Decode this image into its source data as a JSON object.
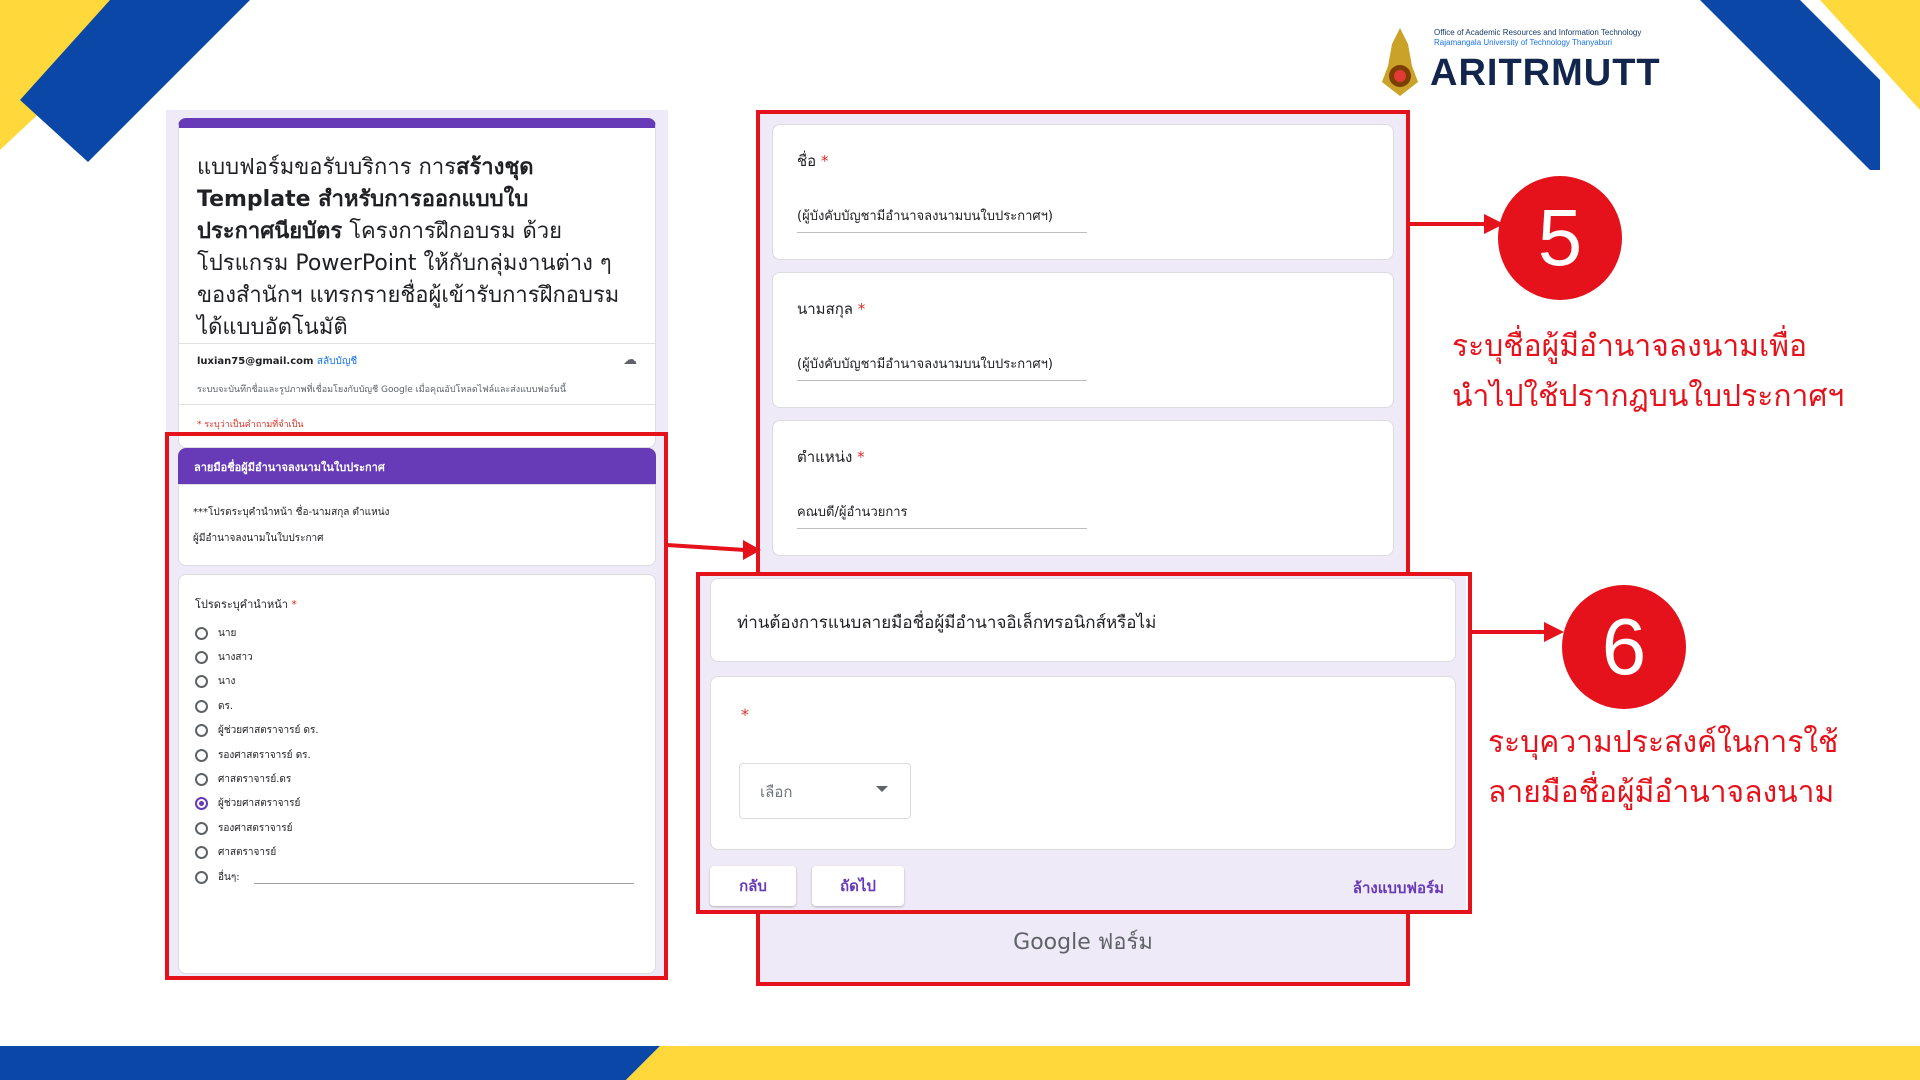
{
  "colors": {
    "accent": "#673ab7",
    "annotation_red": "#e5121b",
    "brand_blue": "#0a47a6",
    "brand_yellow": "#ffd83b"
  },
  "logo": {
    "line1": "Office of Academic Resources and Information Technology",
    "line2": "Rajamangala University of Technology Thanyaburi",
    "wordmark": "ARITRMUTT"
  },
  "left_form": {
    "title_plain1": "แบบฟอร์มขอรับบริการ การ",
    "title_bold": "สร้างชุด Template สำหรับการออกแบบใบประกาศนียบัตร",
    "title_plain2": " โครงการฝึกอบรม ด้วยโปรแกรม PowerPoint ให้กับกลุ่มงานต่าง ๆ ของสำนักฯ แทรกรายชื่อผู้เข้ารับการฝึกอบรมได้แบบอัตโนมัติ",
    "account": "luxian75@gmail.com",
    "switch_account": "สลับบัญชี",
    "save_note": "ระบบจะบันทึกชื่อและรูปภาพที่เชื่อมโยงกับบัญชี Google เมื่อคุณอัปโหลดไฟล์และส่งแบบฟอร์มนี้",
    "required_note": "* ระบุว่าเป็นคำถามที่จำเป็น",
    "section_title": "ลายมือชื่อผู้มีอำนาจลงนามในใบประกาศ",
    "section_desc1": "***โปรดระบุคำนำหน้า ชื่อ-นามสกุล ตำแหน่ง",
    "section_desc2": "ผู้มีอำนาจลงนามในใบประกาศ",
    "question": "โปรดระบุคำนำหน้า",
    "required_mark": "*",
    "options": [
      "นาย",
      "นางสาว",
      "นาง",
      "ดร.",
      "ผู้ช่วยศาสตราจารย์ ดร.",
      "รองศาสตราจารย์ ดร.",
      "ศาสตราจารย์.ดร",
      "ผู้ช่วยศาสตราจารย์",
      "รองศาสตราจารย์",
      "ศาสตราจารย์",
      "อื่นๆ:"
    ],
    "selected_option": "ผู้ช่วยศาสตราจารย์"
  },
  "right_form": {
    "fields": [
      {
        "label": "ชื่อ",
        "value": "(ผู้บังคับบัญชามีอำนาจลงนามบนใบประกาศฯ)"
      },
      {
        "label": "นามสกุล",
        "value": "(ผู้บังคับบัญชามีอำนาจลงนามบนใบประกาศฯ)"
      },
      {
        "label": "ตำแหน่ง",
        "value": "คณบดี/ผู้อำนวยการ"
      }
    ],
    "required_mark": "*",
    "footer_brand": "Google ฟอร์ม"
  },
  "overlay_form": {
    "question": "ท่านต้องการแนบลายมือชื่อผู้มีอำนาจอิเล็กทรอนิกส์หรือไม่",
    "required_mark": "*",
    "select_placeholder": "เลือก",
    "back_button": "กลับ",
    "next_button": "ถัดไป",
    "clear_form": "ล้างแบบฟอร์ม"
  },
  "annotations": [
    {
      "number": "5",
      "caption_line1": "ระบุชื่อผู้มีอำนาจลงนามเพื่อ",
      "caption_line2": "นำไปใช้ปรากฎบนใบประกาศฯ"
    },
    {
      "number": "6",
      "caption_line1": "ระบุความประสงค์ในการใช้",
      "caption_line2": "ลายมือชื่อผู้มีอำนาจลงนาม"
    }
  ]
}
